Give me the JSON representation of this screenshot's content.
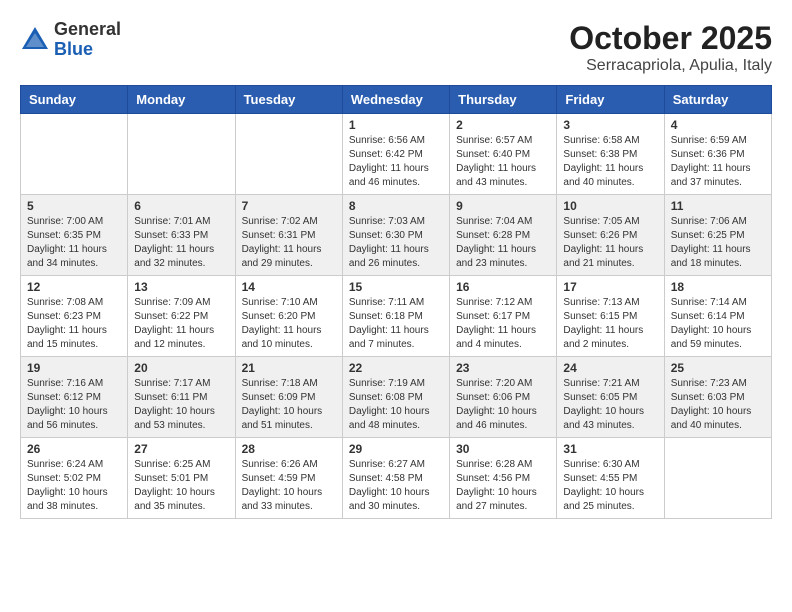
{
  "header": {
    "logo": {
      "general": "General",
      "blue": "Blue"
    },
    "title": "October 2025",
    "location": "Serracapriola, Apulia, Italy"
  },
  "calendar": {
    "days_of_week": [
      "Sunday",
      "Monday",
      "Tuesday",
      "Wednesday",
      "Thursday",
      "Friday",
      "Saturday"
    ],
    "weeks": [
      [
        {
          "day": "",
          "info": ""
        },
        {
          "day": "",
          "info": ""
        },
        {
          "day": "",
          "info": ""
        },
        {
          "day": "1",
          "info": "Sunrise: 6:56 AM\nSunset: 6:42 PM\nDaylight: 11 hours and 46 minutes."
        },
        {
          "day": "2",
          "info": "Sunrise: 6:57 AM\nSunset: 6:40 PM\nDaylight: 11 hours and 43 minutes."
        },
        {
          "day": "3",
          "info": "Sunrise: 6:58 AM\nSunset: 6:38 PM\nDaylight: 11 hours and 40 minutes."
        },
        {
          "day": "4",
          "info": "Sunrise: 6:59 AM\nSunset: 6:36 PM\nDaylight: 11 hours and 37 minutes."
        }
      ],
      [
        {
          "day": "5",
          "info": "Sunrise: 7:00 AM\nSunset: 6:35 PM\nDaylight: 11 hours and 34 minutes."
        },
        {
          "day": "6",
          "info": "Sunrise: 7:01 AM\nSunset: 6:33 PM\nDaylight: 11 hours and 32 minutes."
        },
        {
          "day": "7",
          "info": "Sunrise: 7:02 AM\nSunset: 6:31 PM\nDaylight: 11 hours and 29 minutes."
        },
        {
          "day": "8",
          "info": "Sunrise: 7:03 AM\nSunset: 6:30 PM\nDaylight: 11 hours and 26 minutes."
        },
        {
          "day": "9",
          "info": "Sunrise: 7:04 AM\nSunset: 6:28 PM\nDaylight: 11 hours and 23 minutes."
        },
        {
          "day": "10",
          "info": "Sunrise: 7:05 AM\nSunset: 6:26 PM\nDaylight: 11 hours and 21 minutes."
        },
        {
          "day": "11",
          "info": "Sunrise: 7:06 AM\nSunset: 6:25 PM\nDaylight: 11 hours and 18 minutes."
        }
      ],
      [
        {
          "day": "12",
          "info": "Sunrise: 7:08 AM\nSunset: 6:23 PM\nDaylight: 11 hours and 15 minutes."
        },
        {
          "day": "13",
          "info": "Sunrise: 7:09 AM\nSunset: 6:22 PM\nDaylight: 11 hours and 12 minutes."
        },
        {
          "day": "14",
          "info": "Sunrise: 7:10 AM\nSunset: 6:20 PM\nDaylight: 11 hours and 10 minutes."
        },
        {
          "day": "15",
          "info": "Sunrise: 7:11 AM\nSunset: 6:18 PM\nDaylight: 11 hours and 7 minutes."
        },
        {
          "day": "16",
          "info": "Sunrise: 7:12 AM\nSunset: 6:17 PM\nDaylight: 11 hours and 4 minutes."
        },
        {
          "day": "17",
          "info": "Sunrise: 7:13 AM\nSunset: 6:15 PM\nDaylight: 11 hours and 2 minutes."
        },
        {
          "day": "18",
          "info": "Sunrise: 7:14 AM\nSunset: 6:14 PM\nDaylight: 10 hours and 59 minutes."
        }
      ],
      [
        {
          "day": "19",
          "info": "Sunrise: 7:16 AM\nSunset: 6:12 PM\nDaylight: 10 hours and 56 minutes."
        },
        {
          "day": "20",
          "info": "Sunrise: 7:17 AM\nSunset: 6:11 PM\nDaylight: 10 hours and 53 minutes."
        },
        {
          "day": "21",
          "info": "Sunrise: 7:18 AM\nSunset: 6:09 PM\nDaylight: 10 hours and 51 minutes."
        },
        {
          "day": "22",
          "info": "Sunrise: 7:19 AM\nSunset: 6:08 PM\nDaylight: 10 hours and 48 minutes."
        },
        {
          "day": "23",
          "info": "Sunrise: 7:20 AM\nSunset: 6:06 PM\nDaylight: 10 hours and 46 minutes."
        },
        {
          "day": "24",
          "info": "Sunrise: 7:21 AM\nSunset: 6:05 PM\nDaylight: 10 hours and 43 minutes."
        },
        {
          "day": "25",
          "info": "Sunrise: 7:23 AM\nSunset: 6:03 PM\nDaylight: 10 hours and 40 minutes."
        }
      ],
      [
        {
          "day": "26",
          "info": "Sunrise: 6:24 AM\nSunset: 5:02 PM\nDaylight: 10 hours and 38 minutes."
        },
        {
          "day": "27",
          "info": "Sunrise: 6:25 AM\nSunset: 5:01 PM\nDaylight: 10 hours and 35 minutes."
        },
        {
          "day": "28",
          "info": "Sunrise: 6:26 AM\nSunset: 4:59 PM\nDaylight: 10 hours and 33 minutes."
        },
        {
          "day": "29",
          "info": "Sunrise: 6:27 AM\nSunset: 4:58 PM\nDaylight: 10 hours and 30 minutes."
        },
        {
          "day": "30",
          "info": "Sunrise: 6:28 AM\nSunset: 4:56 PM\nDaylight: 10 hours and 27 minutes."
        },
        {
          "day": "31",
          "info": "Sunrise: 6:30 AM\nSunset: 4:55 PM\nDaylight: 10 hours and 25 minutes."
        },
        {
          "day": "",
          "info": ""
        }
      ]
    ]
  }
}
